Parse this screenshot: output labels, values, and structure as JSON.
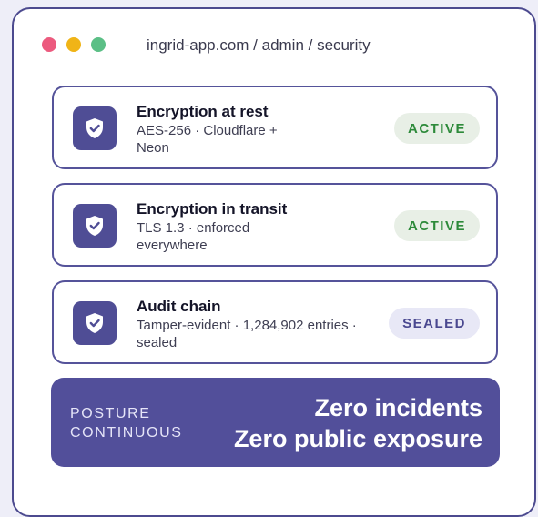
{
  "window": {
    "url": "ingrid-app.com / admin / security",
    "traffic_lights": [
      "#ec5a7e",
      "#f0b417",
      "#5bbf86"
    ]
  },
  "cards": [
    {
      "title": "Encryption at rest",
      "desc_line1": "AES-256 · Cloudflare +",
      "desc_line2": "Neon",
      "status": "ACTIVE",
      "icon": "shield-check-icon"
    },
    {
      "title": "Encryption in transit",
      "desc_line1": "TLS 1.3 · enforced",
      "desc_line2": "everywhere",
      "status": "ACTIVE",
      "icon": "shield-check-icon"
    },
    {
      "title": "Audit chain",
      "desc_line1": "Tamper-evident · 1,284,902 entries ·",
      "desc_line2": "sealed",
      "status": "SEALED",
      "icon": "shield-check-icon"
    }
  ],
  "banner": {
    "label_line1": "POSTURE",
    "label_line2": "CONTINUOUS",
    "headline_line1": "Zero incidents",
    "headline_line2": "Zero public exposure"
  },
  "colors": {
    "accent": "#524f9a",
    "active_text": "#2d8a3a",
    "active_bg": "#e8efe6",
    "sealed_text": "#4a4890",
    "sealed_bg": "#e8e8f6"
  }
}
